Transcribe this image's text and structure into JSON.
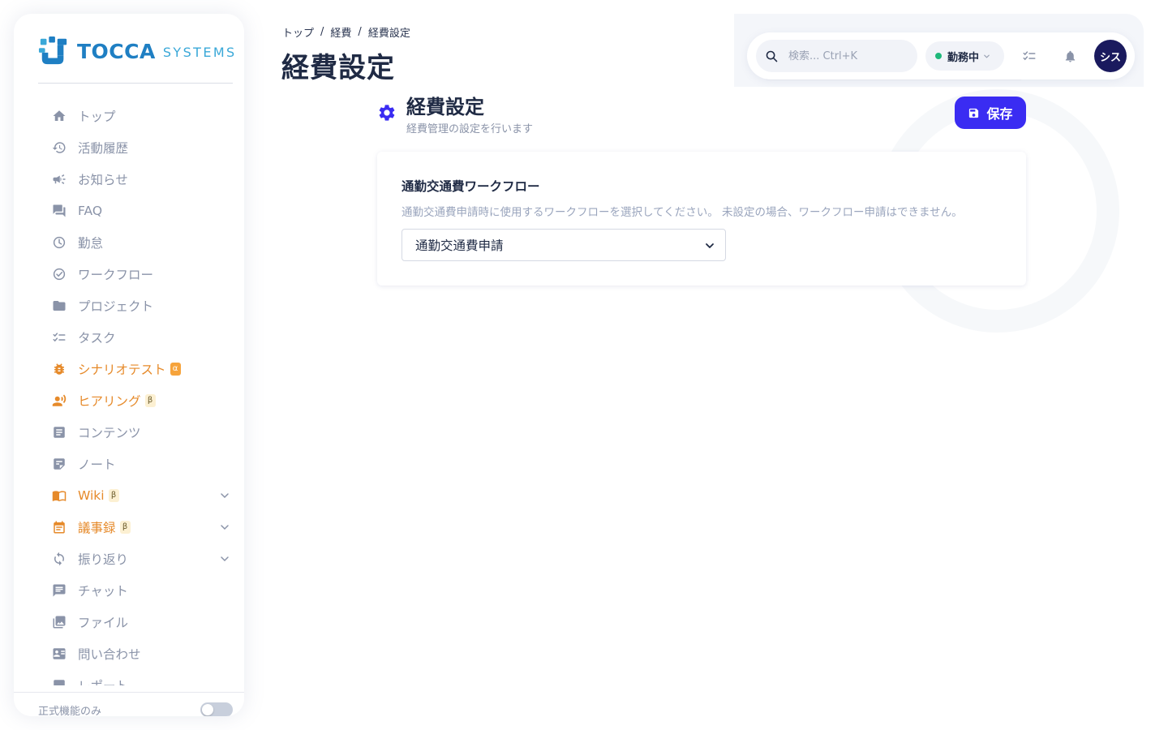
{
  "sidebar": {
    "brand": {
      "name": "TOCCA",
      "suffix": "SYSTEMS"
    },
    "items": [
      {
        "label": "トップ",
        "icon": "home-icon"
      },
      {
        "label": "活動履歴",
        "icon": "history-icon"
      },
      {
        "label": "お知らせ",
        "icon": "megaphone-icon"
      },
      {
        "label": "FAQ",
        "icon": "chat-bubbles-icon"
      },
      {
        "label": "勤怠",
        "icon": "clock-icon"
      },
      {
        "label": "ワークフロー",
        "icon": "check-circle-icon"
      },
      {
        "label": "プロジェクト",
        "icon": "folder-icon"
      },
      {
        "label": "タスク",
        "icon": "checklist-icon"
      },
      {
        "label": "シナリオテスト",
        "icon": "bug-icon",
        "badge": "α"
      },
      {
        "label": "ヒアリング",
        "icon": "people-talk-icon",
        "badge": "β"
      },
      {
        "label": "コンテンツ",
        "icon": "article-icon"
      },
      {
        "label": "ノート",
        "icon": "note-icon"
      },
      {
        "label": "Wiki",
        "icon": "book-icon",
        "badge": "β"
      },
      {
        "label": "議事録",
        "icon": "calendar-icon",
        "badge": "β"
      },
      {
        "label": "振り返り",
        "icon": "refresh-icon"
      },
      {
        "label": "チャット",
        "icon": "message-icon"
      },
      {
        "label": "ファイル",
        "icon": "image-library-icon"
      },
      {
        "label": "問い合わせ",
        "icon": "contact-card-icon"
      },
      {
        "label": "レポート",
        "icon": "report-icon"
      }
    ],
    "footer": {
      "label": "正式機能のみ",
      "toggle_on": false
    }
  },
  "header": {
    "breadcrumb": [
      "トップ",
      "経費",
      "経費設定"
    ],
    "breadcrumb_separator": "/",
    "title": "経費設定"
  },
  "topbar": {
    "search_placeholder": "検索... Ctrl+K",
    "status_label": "勤務中",
    "status_color": "#1fb87a",
    "avatar_text": "シス"
  },
  "content": {
    "title": "経費設定",
    "description": "経費管理の設定を行います",
    "save_label": "保存"
  },
  "card": {
    "title": "通勤交通費ワークフロー",
    "description": "通勤交通費申請時に使用するワークフローを選択してください。 未設定の場合、ワークフロー申請はできません。",
    "selected_value": "通勤交通費申請"
  },
  "colors": {
    "accent": "#3a2cf2",
    "orange": "#e68a2a",
    "text_primary": "#1f2a44",
    "text_muted": "#8a93a8"
  }
}
